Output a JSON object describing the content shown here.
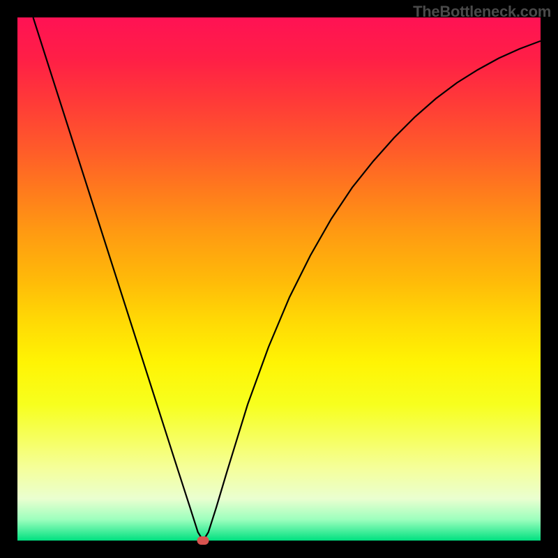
{
  "watermark": "TheBottleneck.com",
  "colors": {
    "frame_bg": "#000000",
    "curve": "#000000",
    "marker": "#d9534f"
  },
  "chart_data": {
    "type": "line",
    "title": "",
    "xlabel": "",
    "ylabel": "",
    "xlim": [
      0,
      100
    ],
    "ylim": [
      0,
      100
    ],
    "grid": false,
    "series": [
      {
        "name": "bottleneck-curve",
        "x": [
          3,
          6,
          10,
          14,
          18,
          22,
          26,
          30,
          33,
          34.5,
          35.5,
          36.5,
          38,
          40,
          44,
          48,
          52,
          56,
          60,
          64,
          68,
          72,
          76,
          80,
          84,
          88,
          92,
          96,
          100
        ],
        "y": [
          100,
          90.6,
          78.1,
          65.6,
          53.1,
          40.6,
          28.1,
          15.6,
          6.3,
          1.6,
          0,
          1.6,
          6.3,
          13,
          26,
          37,
          46.5,
          54.5,
          61.5,
          67.5,
          72.5,
          77,
          81,
          84.5,
          87.5,
          90,
          92.2,
          94,
          95.5
        ]
      }
    ],
    "annotations": [
      {
        "name": "min-marker",
        "x": 35.5,
        "y": 0
      }
    ]
  }
}
